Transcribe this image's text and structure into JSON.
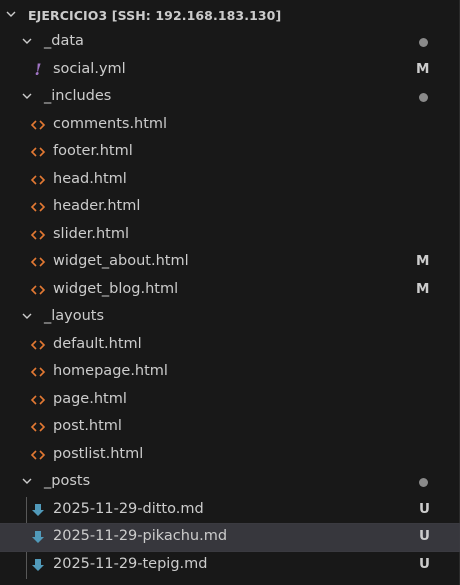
{
  "explorer": {
    "title": "EJERCICIO3 [SSH: 192.168.183.130]"
  },
  "colors": {
    "html_icon": "#e37933",
    "md_icon": "#519aba",
    "yml_icon": "#a074c4",
    "selected_bg": "#37373d"
  },
  "tree": {
    "data": {
      "label": "_data",
      "indicator": "dot",
      "files": [
        {
          "name": "social.yml",
          "icon": "yml-exclamation-icon",
          "badge": "M"
        }
      ]
    },
    "includes": {
      "label": "_includes",
      "indicator": "dot",
      "files": [
        {
          "name": "comments.html",
          "icon": "html-code-icon",
          "badge": ""
        },
        {
          "name": "footer.html",
          "icon": "html-code-icon",
          "badge": ""
        },
        {
          "name": "head.html",
          "icon": "html-code-icon",
          "badge": ""
        },
        {
          "name": "header.html",
          "icon": "html-code-icon",
          "badge": ""
        },
        {
          "name": "slider.html",
          "icon": "html-code-icon",
          "badge": ""
        },
        {
          "name": "widget_about.html",
          "icon": "html-code-icon",
          "badge": "M"
        },
        {
          "name": "widget_blog.html",
          "icon": "html-code-icon",
          "badge": "M"
        }
      ]
    },
    "layouts": {
      "label": "_layouts",
      "indicator": "",
      "files": [
        {
          "name": "default.html",
          "icon": "html-code-icon",
          "badge": ""
        },
        {
          "name": "homepage.html",
          "icon": "html-code-icon",
          "badge": ""
        },
        {
          "name": "page.html",
          "icon": "html-code-icon",
          "badge": ""
        },
        {
          "name": "post.html",
          "icon": "html-code-icon",
          "badge": ""
        },
        {
          "name": "postlist.html",
          "icon": "html-code-icon",
          "badge": ""
        }
      ]
    },
    "posts": {
      "label": "_posts",
      "indicator": "dot",
      "files": [
        {
          "name": "2025-11-29-ditto.md",
          "icon": "markdown-arrow-icon",
          "badge": "U"
        },
        {
          "name": "2025-11-29-pikachu.md",
          "icon": "markdown-arrow-icon",
          "badge": "U"
        },
        {
          "name": "2025-11-29-tepig.md",
          "icon": "markdown-arrow-icon",
          "badge": "U"
        }
      ]
    }
  }
}
